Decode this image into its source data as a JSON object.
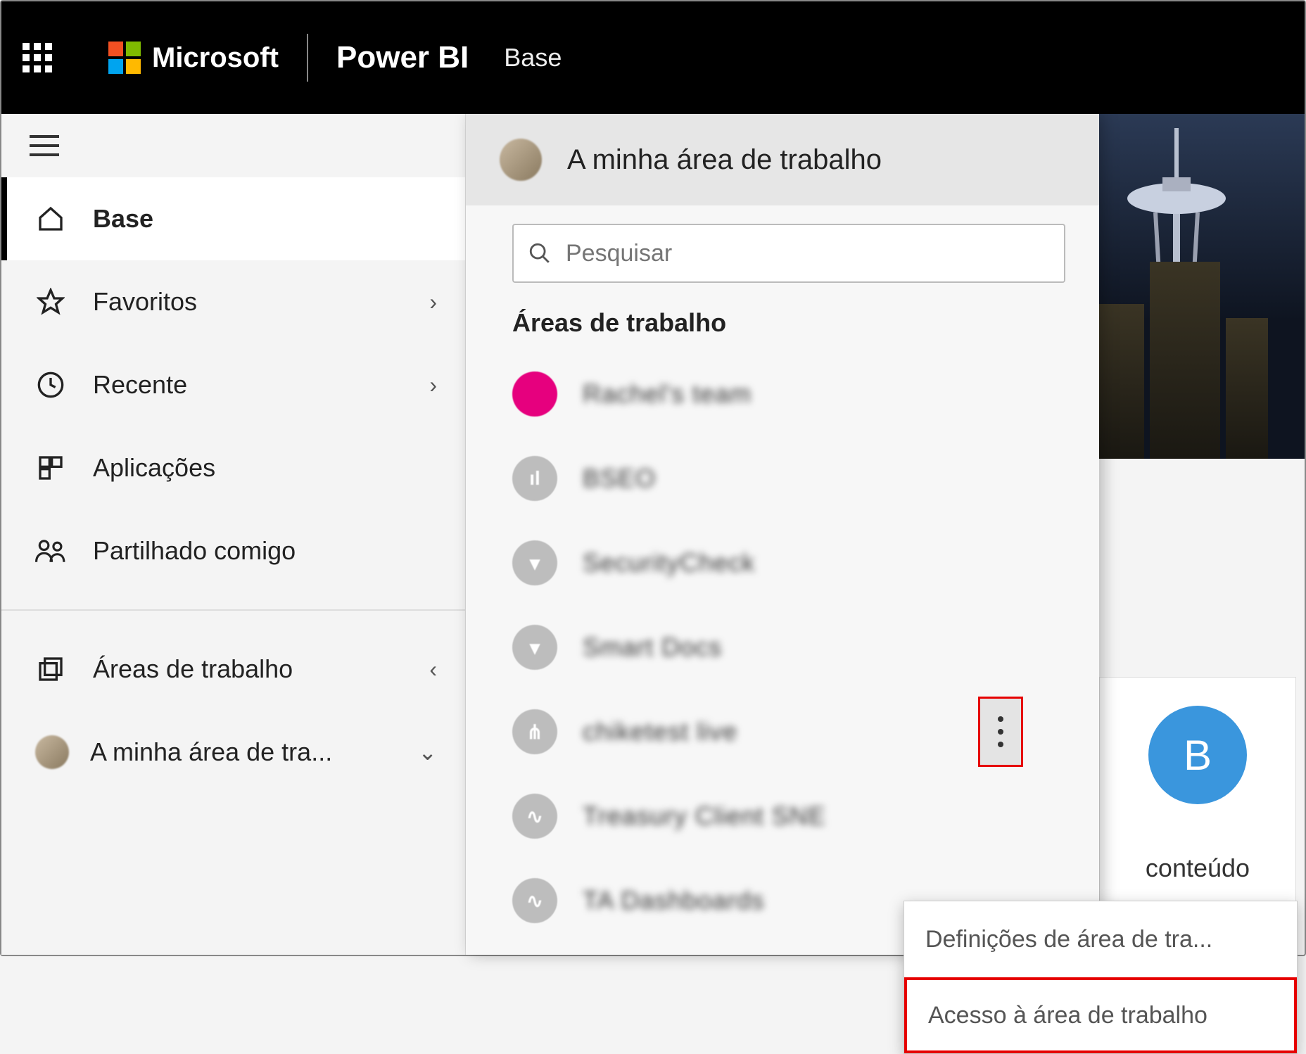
{
  "header": {
    "company": "Microsoft",
    "product": "Power BI",
    "breadcrumb": "Base"
  },
  "sidebar": {
    "items": [
      {
        "label": "Base",
        "icon": "home",
        "active": true
      },
      {
        "label": "Favoritos",
        "icon": "star",
        "chevron": ">"
      },
      {
        "label": "Recente",
        "icon": "clock",
        "chevron": ">"
      },
      {
        "label": "Aplicações",
        "icon": "apps"
      },
      {
        "label": "Partilhado comigo",
        "icon": "shared"
      }
    ],
    "lower": [
      {
        "label": "Áreas de trabalho",
        "icon": "workspaces",
        "chevron": "<"
      },
      {
        "label": "A minha área de tra...",
        "icon": "avatar",
        "chevron": "v"
      }
    ]
  },
  "flyout": {
    "title": "A minha área de trabalho",
    "search_placeholder": "Pesquisar",
    "section": "Áreas de trabalho",
    "workspaces": [
      {
        "name": "Rachel's team",
        "color": "pink"
      },
      {
        "name": "BSEO",
        "color": "grey"
      },
      {
        "name": "SecurityCheck",
        "color": "grey"
      },
      {
        "name": "Smart Docs",
        "color": "grey"
      },
      {
        "name": "chiketest live",
        "color": "grey",
        "more": true
      },
      {
        "name": "Treasury Client SNE",
        "color": "grey"
      },
      {
        "name": "TA Dashboards",
        "color": "grey"
      }
    ]
  },
  "context_menu": {
    "items": [
      {
        "label": "Definições de área de tra..."
      },
      {
        "label": "Acesso à área de trabalho",
        "highlight": true
      }
    ]
  },
  "card": {
    "letter": "B",
    "text": "conteúdo"
  }
}
